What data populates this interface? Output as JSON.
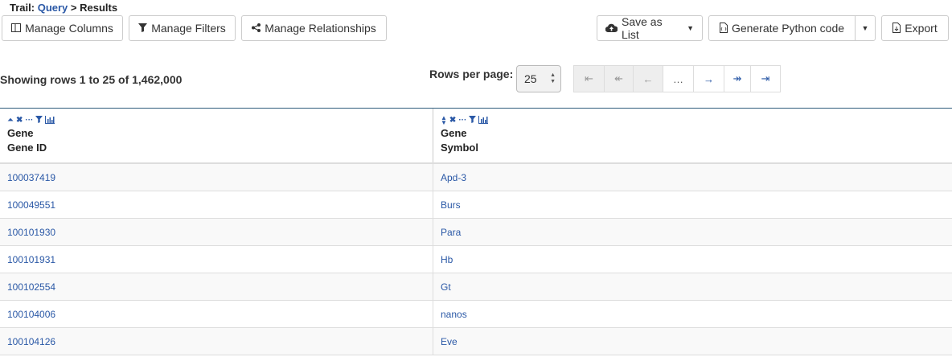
{
  "trail": {
    "label": "Trail:",
    "link": "Query",
    "sep": ">",
    "current": "Results"
  },
  "toolbar": {
    "manage_columns": "Manage Columns",
    "manage_filters": "Manage Filters",
    "manage_relationships": "Manage Relationships",
    "save_as_list": "Save as List",
    "generate_python": "Generate Python code",
    "export": "Export"
  },
  "summary": {
    "showing": "Showing rows 1 to 25 of 1,462,000"
  },
  "pagination": {
    "rows_per_page_label": "Rows per page:",
    "rows_per_page_value": "25",
    "first": "⇤",
    "prev_page": "↞",
    "prev": "←",
    "ellipsis": "…",
    "next": "→",
    "next_page": "↠",
    "last": "⇥"
  },
  "table": {
    "columns": [
      {
        "group": "Gene",
        "field": "Gene ID"
      },
      {
        "group": "Gene",
        "field": "Symbol"
      }
    ],
    "rows": [
      [
        "100037419",
        "Apd-3"
      ],
      [
        "100049551",
        "Burs"
      ],
      [
        "100101930",
        "Para"
      ],
      [
        "100101931",
        "Hb"
      ],
      [
        "100102554",
        "Gt"
      ],
      [
        "100104006",
        "nanos"
      ],
      [
        "100104126",
        "Eve"
      ]
    ]
  },
  "colors": {
    "link": "#2a58a6",
    "header_rule": "#2e5b7a"
  },
  "icons": [
    "columns-icon",
    "filter-icon",
    "share-icon",
    "cloud-upload-icon",
    "python-file-icon",
    "export-file-icon",
    "caret-down-icon",
    "sort-icon",
    "remove-icon",
    "more-icon",
    "filter-icon",
    "histogram-icon"
  ]
}
